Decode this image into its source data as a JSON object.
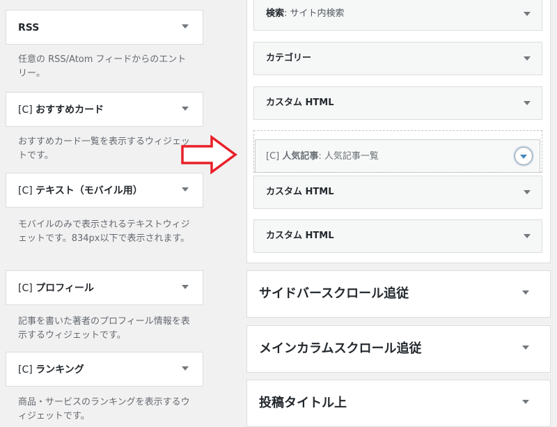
{
  "available_widgets": [
    {
      "prefix": "",
      "title": "RSS",
      "description": "任意の RSS/Atom フィードからのエントリー。"
    },
    {
      "prefix": "[C] ",
      "title": "おすすめカード",
      "description": "おすすめカード一覧を表示するウィジェットです。"
    },
    {
      "prefix": "[C] ",
      "title": "テキスト（モバイル用）",
      "description": "モバイルのみで表示されるテキストウィジェットです。834px以下で表示されます。"
    },
    {
      "prefix": "[C] ",
      "title": "プロフィール",
      "description": "記事を書いた著者のプロフィール情報を表示するウィジェットです。"
    },
    {
      "prefix": "[C] ",
      "title": "ランキング",
      "description": "商品・サービスのランキングを表示するウィジェットです。"
    }
  ],
  "sidebar_widgets": [
    {
      "title": "検索",
      "subtitle": ": サイト内検索"
    },
    {
      "title": "カテゴリー",
      "subtitle": ""
    },
    {
      "title": "カスタム HTML",
      "subtitle": ""
    },
    {
      "title": "カスタム HTML",
      "subtitle": ""
    },
    {
      "title": "カスタム HTML",
      "subtitle": ""
    }
  ],
  "dragging_widget": {
    "prefix": "[C] ",
    "title": "人気記事",
    "subtitle": ": 人気記事一覧"
  },
  "widget_areas": [
    {
      "title": "サイドバースクロール追従"
    },
    {
      "title": "メインカラムスクロール追従"
    },
    {
      "title": "投稿タイトル上"
    }
  ],
  "colors": {
    "arrow_stroke": "#e8202a",
    "accent": "#2271b1"
  },
  "icons": {
    "drop_arrow": "right-arrow-icon",
    "toggle": "chevron-down-icon"
  }
}
